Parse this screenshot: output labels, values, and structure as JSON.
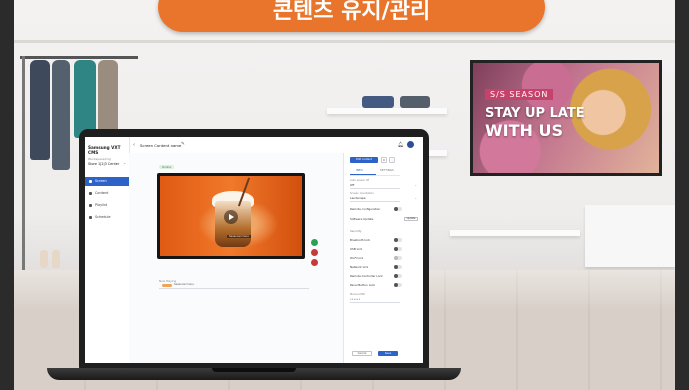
{
  "banner": {
    "title": "콘텐츠 유지/관리"
  },
  "wall_display": {
    "tag": "S/S SEASON",
    "line1": "STAY UP LATE",
    "line2": "WITH US"
  },
  "app": {
    "brand": "Samsung VXT CMS",
    "org_label": "Workspace/Org",
    "org_name": "Store 1|2|3 Center",
    "nav": [
      {
        "label": "Screen"
      },
      {
        "label": "Content"
      },
      {
        "label": "Playlist"
      },
      {
        "label": "Schedule"
      }
    ],
    "breadcrumb": "Screen Content name",
    "status_badge": "Online",
    "preview_caption": "Seasonal menu",
    "schedule": {
      "label": "Now Playing",
      "item_name": "Seasonal menu"
    },
    "panel": {
      "primary_button": "Edit content",
      "tabs": [
        "INFO",
        "SETTINGS"
      ],
      "fields": [
        {
          "label": "Auto power off",
          "value": "Off"
        },
        {
          "label": "Screen orientation",
          "value": "Landscape"
        }
      ],
      "toggles_top": [
        {
          "label": "Remote configuration"
        }
      ],
      "updater": {
        "label": "Software Update",
        "button": "Update"
      },
      "security_label": "Security",
      "toggles": [
        {
          "label": "Bluetooth lock"
        },
        {
          "label": "USB lock"
        },
        {
          "label": "Wi-Fi lock"
        },
        {
          "label": "Network lock"
        },
        {
          "label": "Remote Controller Lock"
        },
        {
          "label": "Panel Button Lock"
        }
      ],
      "manual_label": "Manual PIN",
      "manual_value": "••••••",
      "cancel": "Cancel",
      "save": "Save"
    }
  },
  "colors": {
    "accent_orange": "#e8752b",
    "cms_blue": "#2d62c8"
  }
}
